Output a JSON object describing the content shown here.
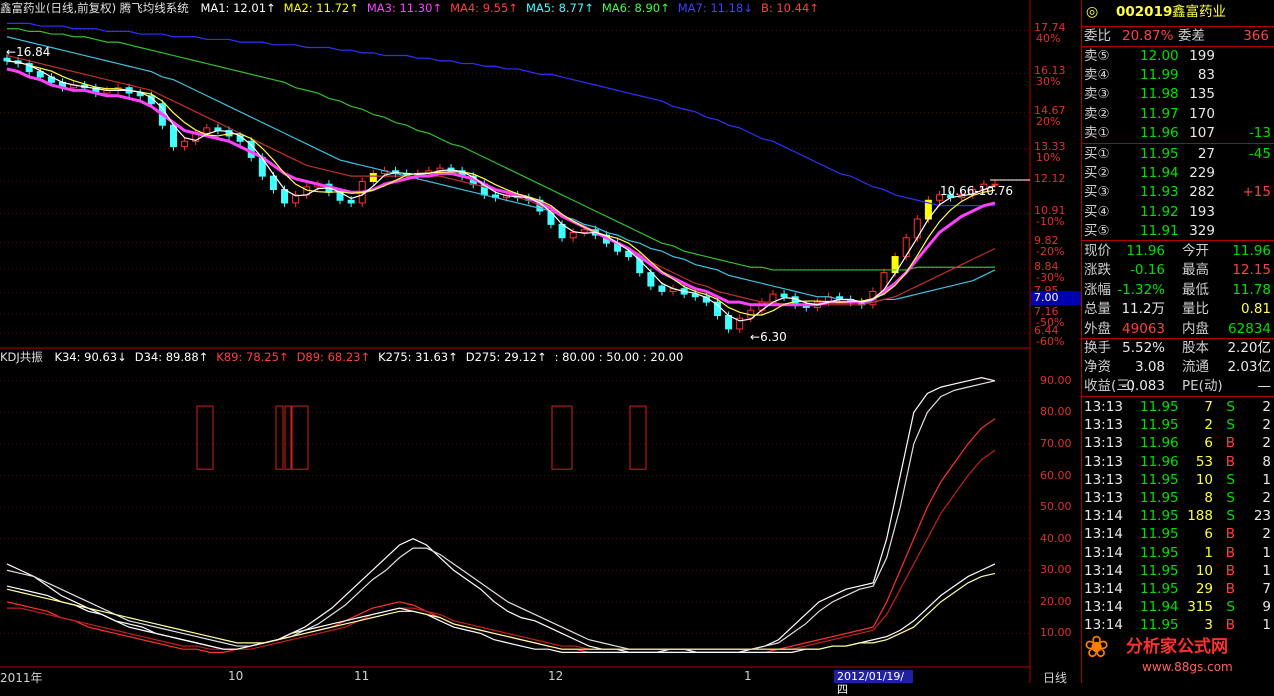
{
  "header": {
    "title": "鑫富药业(日线,前复权) 腾飞均线系统",
    "ma": [
      {
        "label": "MA1: 12.01",
        "arrow": "↑",
        "color": "#ffffff"
      },
      {
        "label": "MA2: 11.72",
        "arrow": "↑",
        "color": "#ffff00"
      },
      {
        "label": "MA3: 11.30",
        "arrow": "↑",
        "color": "#ff40ff"
      },
      {
        "label": "MA4: 9.55",
        "arrow": "↑",
        "color": "#ff4040"
      },
      {
        "label": "MA5: 8.77",
        "arrow": "↑",
        "color": "#40ffff"
      },
      {
        "label": "MA6: 8.90",
        "arrow": "↑",
        "color": "#40ff40"
      },
      {
        "label": "MA7: 11.18",
        "arrow": "↓",
        "color": "#4040ff"
      },
      {
        "label": "B: 10.44",
        "arrow": "↑",
        "color": "#ff4040"
      }
    ]
  },
  "sub_header": {
    "title": "KDJ共振",
    "items": [
      {
        "label": "K34: 90.63",
        "arrow": "↓",
        "color": "#ffffff"
      },
      {
        "label": "D34: 89.88",
        "arrow": "↑",
        "color": "#ffffff"
      },
      {
        "label": "K89: 78.25",
        "arrow": "↑",
        "color": "#ff4040"
      },
      {
        "label": "D89: 68.23",
        "arrow": "↑",
        "color": "#ff4040"
      },
      {
        "label": "K275: 31.63",
        "arrow": "↑",
        "color": "#ffffff"
      },
      {
        "label": "D275: 29.12",
        "arrow": "↑",
        "color": "#ffffff"
      },
      {
        "label": ": 80.00 : 50.00 : 20.00",
        "arrow": "",
        "color": "#ffffff"
      }
    ]
  },
  "price_axis": [
    {
      "price": "17.74",
      "pct": "40%"
    },
    {
      "price": "16.13",
      "pct": "30%"
    },
    {
      "price": "14.67",
      "pct": "20%"
    },
    {
      "price": "13.33",
      "pct": "10%"
    },
    {
      "price": "12.12",
      "pct": ""
    },
    {
      "price": "10.91",
      "pct": "-10%"
    },
    {
      "price": "9.82",
      "pct": "-20%"
    },
    {
      "price": "8.84",
      "pct": "-30%"
    },
    {
      "price": "7.95",
      "pct": "-40%"
    },
    {
      "price": "7.16",
      "pct": "-50%"
    },
    {
      "price": "6.44",
      "pct": "-60%"
    }
  ],
  "kdj_axis": [
    "90.00",
    "80.00",
    "70.00",
    "60.00",
    "50.00",
    "40.00",
    "30.00",
    "20.00",
    "10.00"
  ],
  "annotations": {
    "high": "16.84",
    "low": "6.30",
    "cross": "10.66-10.76",
    "badge": "7.00"
  },
  "x_axis": {
    "labels": [
      "2011年",
      "10",
      "11",
      "12",
      "1",
      "2012/01/19/四"
    ],
    "period": "日线"
  },
  "chart_data": {
    "type": "candlestick",
    "ylim": [
      6.0,
      18.2
    ],
    "kdj_ylim": [
      0,
      95
    ],
    "close": [
      16.6,
      16.5,
      16.2,
      16.0,
      15.8,
      15.6,
      15.7,
      15.6,
      15.4,
      15.5,
      15.6,
      15.4,
      15.3,
      15.0,
      14.2,
      13.4,
      13.6,
      13.9,
      14.1,
      14.0,
      13.8,
      13.6,
      13.0,
      12.3,
      11.8,
      11.3,
      11.6,
      11.9,
      12.0,
      11.7,
      11.4,
      11.3,
      12.1,
      12.4,
      12.5,
      12.4,
      12.3,
      12.4,
      12.5,
      12.6,
      12.5,
      12.3,
      12.0,
      11.6,
      11.5,
      11.6,
      11.5,
      11.4,
      11.0,
      10.5,
      10.0,
      10.2,
      10.3,
      10.1,
      9.8,
      9.5,
      9.3,
      8.7,
      8.2,
      8.0,
      8.1,
      7.9,
      7.8,
      7.6,
      7.1,
      6.6,
      7.0,
      7.3,
      7.6,
      7.9,
      7.8,
      7.5,
      7.4,
      7.6,
      7.8,
      7.7,
      7.6,
      7.5,
      8.0,
      8.7,
      9.3,
      10.0,
      10.7,
      11.4,
      11.6,
      11.5,
      11.6,
      11.8,
      12.0,
      12.0
    ],
    "ma3": [
      16.3,
      16.2,
      16.0,
      15.9,
      15.7,
      15.6,
      15.5,
      15.5,
      15.4,
      15.3,
      15.3,
      15.2,
      15.1,
      14.9,
      14.6,
      14.3,
      14.0,
      13.9,
      13.8,
      13.7,
      13.6,
      13.4,
      13.2,
      13.0,
      12.7,
      12.4,
      12.2,
      12.1,
      12.0,
      11.9,
      11.8,
      11.7,
      11.7,
      11.8,
      12.0,
      12.1,
      12.2,
      12.3,
      12.3,
      12.4,
      12.4,
      12.3,
      12.2,
      12.0,
      11.8,
      11.7,
      11.6,
      11.5,
      11.3,
      11.1,
      10.8,
      10.6,
      10.4,
      10.2,
      10.0,
      9.8,
      9.6,
      9.3,
      9.0,
      8.7,
      8.5,
      8.3,
      8.1,
      8.0,
      7.8,
      7.6,
      7.6,
      7.5,
      7.5,
      7.5,
      7.5,
      7.5,
      7.5,
      7.5,
      7.6,
      7.6,
      7.6,
      7.6,
      7.7,
      8.0,
      8.3,
      8.7,
      9.2,
      9.7,
      10.2,
      10.5,
      10.8,
      11.0,
      11.2,
      11.3
    ],
    "ma4": [
      16.8,
      16.7,
      16.6,
      16.5,
      16.4,
      16.3,
      16.2,
      16.1,
      16.0,
      15.9,
      15.8,
      15.7,
      15.6,
      15.5,
      15.3,
      15.1,
      14.9,
      14.7,
      14.5,
      14.3,
      14.1,
      13.9,
      13.7,
      13.5,
      13.3,
      13.1,
      12.9,
      12.7,
      12.6,
      12.5,
      12.4,
      12.3,
      12.3,
      12.3,
      12.3,
      12.3,
      12.3,
      12.3,
      12.3,
      12.3,
      12.2,
      12.1,
      12.0,
      11.9,
      11.8,
      11.7,
      11.5,
      11.4,
      11.2,
      11.0,
      10.8,
      10.6,
      10.4,
      10.2,
      10.0,
      9.8,
      9.6,
      9.4,
      9.1,
      8.9,
      8.7,
      8.5,
      8.3,
      8.2,
      8.0,
      7.9,
      7.8,
      7.7,
      7.6,
      7.6,
      7.5,
      7.5,
      7.5,
      7.5,
      7.5,
      7.5,
      7.5,
      7.5,
      7.6,
      7.7,
      7.8,
      8.0,
      8.2,
      8.4,
      8.6,
      8.8,
      9.0,
      9.2,
      9.4,
      9.6
    ],
    "ma5": [
      17.5,
      17.4,
      17.3,
      17.2,
      17.1,
      17.0,
      16.9,
      16.8,
      16.7,
      16.6,
      16.5,
      16.4,
      16.3,
      16.2,
      16.0,
      15.9,
      15.7,
      15.5,
      15.3,
      15.1,
      14.9,
      14.7,
      14.5,
      14.3,
      14.1,
      13.9,
      13.7,
      13.5,
      13.3,
      13.1,
      12.9,
      12.8,
      12.7,
      12.6,
      12.5,
      12.4,
      12.3,
      12.2,
      12.1,
      12.0,
      11.9,
      11.8,
      11.7,
      11.6,
      11.5,
      11.4,
      11.3,
      11.2,
      11.1,
      11.0,
      10.8,
      10.7,
      10.5,
      10.4,
      10.2,
      10.1,
      9.9,
      9.8,
      9.6,
      9.5,
      9.3,
      9.2,
      9.0,
      8.9,
      8.8,
      8.6,
      8.5,
      8.4,
      8.3,
      8.2,
      8.1,
      8.0,
      7.9,
      7.8,
      7.8,
      7.7,
      7.7,
      7.6,
      7.6,
      7.7,
      7.7,
      7.8,
      7.9,
      8.0,
      8.1,
      8.2,
      8.3,
      8.4,
      8.6,
      8.8
    ],
    "ma6": [
      17.8,
      17.8,
      17.7,
      17.7,
      17.6,
      17.6,
      17.5,
      17.5,
      17.4,
      17.3,
      17.3,
      17.2,
      17.1,
      17.0,
      16.9,
      16.8,
      16.7,
      16.6,
      16.5,
      16.4,
      16.3,
      16.2,
      16.1,
      16.0,
      15.9,
      15.8,
      15.6,
      15.5,
      15.4,
      15.2,
      15.1,
      14.9,
      14.8,
      14.6,
      14.5,
      14.3,
      14.2,
      14.0,
      13.9,
      13.7,
      13.5,
      13.4,
      13.2,
      13.0,
      12.8,
      12.6,
      12.4,
      12.2,
      12.0,
      11.8,
      11.6,
      11.4,
      11.2,
      11.0,
      10.8,
      10.6,
      10.4,
      10.2,
      10.0,
      9.8,
      9.7,
      9.5,
      9.4,
      9.3,
      9.2,
      9.1,
      9.0,
      8.9,
      8.9,
      8.8,
      8.8,
      8.8,
      8.8,
      8.8,
      8.8,
      8.8,
      8.8,
      8.8,
      8.8,
      8.8,
      8.8,
      8.8,
      8.9,
      8.9,
      8.9,
      8.9,
      8.9,
      8.9,
      8.9,
      8.9
    ],
    "ma7": [
      18.0,
      18.0,
      18.0,
      17.9,
      17.9,
      17.9,
      17.8,
      17.8,
      17.8,
      17.7,
      17.7,
      17.7,
      17.6,
      17.6,
      17.6,
      17.5,
      17.5,
      17.5,
      17.4,
      17.4,
      17.4,
      17.3,
      17.3,
      17.3,
      17.2,
      17.2,
      17.2,
      17.1,
      17.1,
      17.1,
      17.0,
      17.0,
      16.9,
      16.9,
      16.8,
      16.8,
      16.8,
      16.7,
      16.7,
      16.6,
      16.6,
      16.5,
      16.5,
      16.4,
      16.4,
      16.3,
      16.3,
      16.2,
      16.1,
      16.1,
      16.0,
      15.9,
      15.8,
      15.7,
      15.6,
      15.5,
      15.4,
      15.3,
      15.2,
      15.1,
      14.9,
      14.8,
      14.7,
      14.5,
      14.4,
      14.2,
      14.1,
      13.9,
      13.7,
      13.6,
      13.4,
      13.2,
      13.0,
      12.8,
      12.6,
      12.4,
      12.3,
      12.1,
      11.9,
      11.8,
      11.6,
      11.5,
      11.4,
      11.3,
      11.2,
      11.2,
      11.2,
      11.2,
      11.2,
      11.2
    ],
    "k34": [
      32,
      30,
      28,
      25,
      22,
      20,
      18,
      16,
      14,
      12,
      11,
      10,
      9,
      8,
      7,
      6,
      5,
      5,
      6,
      7,
      8,
      10,
      12,
      15,
      18,
      22,
      26,
      30,
      34,
      38,
      40,
      38,
      34,
      30,
      27,
      24,
      20,
      17,
      15,
      14,
      12,
      10,
      8,
      6,
      5,
      5,
      4,
      4,
      4,
      5,
      5,
      4,
      4,
      4,
      4,
      5,
      6,
      8,
      12,
      16,
      20,
      22,
      24,
      25,
      26,
      40,
      60,
      80,
      86,
      88,
      89,
      90,
      91,
      90
    ],
    "d34": [
      30,
      29,
      28,
      26,
      24,
      22,
      20,
      18,
      16,
      14,
      13,
      12,
      11,
      10,
      9,
      8,
      7,
      6,
      6,
      7,
      8,
      9,
      11,
      13,
      16,
      19,
      23,
      27,
      30,
      34,
      37,
      37,
      35,
      32,
      29,
      26,
      23,
      20,
      18,
      16,
      14,
      12,
      10,
      8,
      7,
      6,
      5,
      5,
      5,
      5,
      5,
      5,
      5,
      5,
      5,
      5,
      6,
      7,
      10,
      13,
      17,
      20,
      22,
      24,
      25,
      34,
      50,
      70,
      80,
      85,
      87,
      88,
      89,
      90
    ],
    "k89": [
      20,
      19,
      18,
      17,
      15,
      14,
      12,
      11,
      10,
      9,
      8,
      7,
      6,
      5,
      5,
      4,
      4,
      5,
      6,
      7,
      8,
      9,
      10,
      11,
      12,
      14,
      16,
      18,
      19,
      20,
      19,
      17,
      15,
      13,
      12,
      11,
      10,
      9,
      8,
      7,
      6,
      5,
      5,
      4,
      4,
      4,
      4,
      4,
      4,
      4,
      4,
      4,
      4,
      4,
      4,
      4,
      4,
      5,
      6,
      7,
      8,
      9,
      10,
      11,
      12,
      20,
      30,
      40,
      50,
      58,
      64,
      70,
      75,
      78
    ],
    "d89": [
      18,
      18,
      17,
      16,
      15,
      14,
      13,
      12,
      11,
      10,
      9,
      8,
      7,
      6,
      6,
      5,
      5,
      5,
      5,
      6,
      7,
      8,
      9,
      10,
      11,
      12,
      14,
      16,
      17,
      18,
      18,
      17,
      16,
      14,
      13,
      12,
      11,
      10,
      9,
      8,
      7,
      6,
      6,
      5,
      5,
      5,
      5,
      5,
      5,
      5,
      5,
      5,
      5,
      5,
      5,
      5,
      5,
      5,
      5,
      6,
      7,
      8,
      9,
      10,
      11,
      16,
      24,
      32,
      40,
      48,
      54,
      60,
      65,
      68
    ],
    "k275": [
      25,
      24,
      23,
      22,
      20,
      19,
      17,
      16,
      14,
      13,
      12,
      10,
      9,
      8,
      7,
      6,
      5,
      5,
      6,
      7,
      8,
      10,
      11,
      12,
      13,
      14,
      15,
      16,
      17,
      18,
      17,
      16,
      14,
      12,
      11,
      10,
      8,
      7,
      6,
      5,
      5,
      4,
      4,
      4,
      4,
      4,
      4,
      4,
      4,
      4,
      4,
      4,
      4,
      4,
      4,
      4,
      4,
      4,
      4,
      5,
      5,
      6,
      6,
      7,
      8,
      9,
      11,
      14,
      18,
      22,
      25,
      28,
      30,
      32
    ],
    "d275": [
      24,
      23,
      22,
      21,
      20,
      19,
      18,
      17,
      16,
      15,
      14,
      13,
      12,
      11,
      10,
      9,
      8,
      7,
      7,
      7,
      8,
      9,
      10,
      11,
      12,
      13,
      14,
      15,
      16,
      17,
      17,
      16,
      15,
      13,
      12,
      11,
      10,
      9,
      8,
      7,
      6,
      5,
      5,
      5,
      5,
      5,
      5,
      5,
      5,
      5,
      5,
      5,
      5,
      5,
      5,
      5,
      5,
      5,
      5,
      5,
      5,
      6,
      6,
      7,
      7,
      8,
      10,
      12,
      16,
      20,
      23,
      26,
      28,
      29
    ],
    "signal_boxes": [
      [
        197,
        213
      ],
      [
        276,
        283
      ],
      [
        285,
        291
      ],
      [
        292,
        308
      ],
      [
        552,
        572
      ],
      [
        630,
        646
      ]
    ]
  },
  "panel": {
    "code": "002019",
    "name": "鑫富药业",
    "weibi_label": "委比",
    "weibi": "20.87%",
    "weicha_label": "委差",
    "weicha": "366",
    "asks": [
      {
        "label": "卖⑤",
        "price": "12.00",
        "vol": "199",
        "chg": ""
      },
      {
        "label": "卖④",
        "price": "11.99",
        "vol": "83",
        "chg": ""
      },
      {
        "label": "卖③",
        "price": "11.98",
        "vol": "135",
        "chg": ""
      },
      {
        "label": "卖②",
        "price": "11.97",
        "vol": "170",
        "chg": ""
      },
      {
        "label": "卖①",
        "price": "11.96",
        "vol": "107",
        "chg": "-13"
      }
    ],
    "bids": [
      {
        "label": "买①",
        "price": "11.95",
        "vol": "27",
        "chg": "-45"
      },
      {
        "label": "买②",
        "price": "11.94",
        "vol": "229",
        "chg": ""
      },
      {
        "label": "买③",
        "price": "11.93",
        "vol": "282",
        "chg": "+15"
      },
      {
        "label": "买④",
        "price": "11.92",
        "vol": "193",
        "chg": ""
      },
      {
        "label": "买⑤",
        "price": "11.91",
        "vol": "329",
        "chg": ""
      }
    ],
    "quote": [
      {
        "l1": "现价",
        "v1": "11.96",
        "c1": "g",
        "l2": "今开",
        "v2": "11.96",
        "c2": "g"
      },
      {
        "l1": "涨跌",
        "v1": "-0.16",
        "c1": "g",
        "l2": "最高",
        "v2": "12.15",
        "c2": "r"
      },
      {
        "l1": "涨幅",
        "v1": "-1.32%",
        "c1": "g",
        "l2": "最低",
        "v2": "11.78",
        "c2": "g"
      },
      {
        "l1": "总量",
        "v1": "11.2万",
        "c1": "w",
        "l2": "量比",
        "v2": "0.81",
        "c2": "y"
      },
      {
        "l1": "外盘",
        "v1": "49063",
        "c1": "r",
        "l2": "内盘",
        "v2": "62834",
        "c2": "g"
      }
    ],
    "fund": [
      {
        "l1": "换手",
        "v1": "5.52%",
        "l2": "股本",
        "v2": "2.20亿"
      },
      {
        "l1": "净资",
        "v1": "3.08",
        "l2": "流通",
        "v2": "2.03亿"
      },
      {
        "l1": "收益(三)",
        "v1": "-0.083",
        "l2": "PE(动)",
        "v2": "—"
      }
    ],
    "ticks": [
      {
        "time": "13:13",
        "price": "11.95",
        "vol": "7",
        "side": "S",
        "n": "2"
      },
      {
        "time": "13:13",
        "price": "11.95",
        "vol": "2",
        "side": "S",
        "n": "2"
      },
      {
        "time": "13:13",
        "price": "11.96",
        "vol": "6",
        "side": "B",
        "n": "2"
      },
      {
        "time": "13:13",
        "price": "11.96",
        "vol": "53",
        "side": "B",
        "n": "8"
      },
      {
        "time": "13:13",
        "price": "11.95",
        "vol": "10",
        "side": "S",
        "n": "1"
      },
      {
        "time": "13:13",
        "price": "11.95",
        "vol": "8",
        "side": "S",
        "n": "2"
      },
      {
        "time": "13:14",
        "price": "11.95",
        "vol": "188",
        "side": "S",
        "n": "23"
      },
      {
        "time": "13:14",
        "price": "11.95",
        "vol": "6",
        "side": "B",
        "n": "2"
      },
      {
        "time": "13:14",
        "price": "11.95",
        "vol": "1",
        "side": "B",
        "n": "1"
      },
      {
        "time": "13:14",
        "price": "11.95",
        "vol": "10",
        "side": "B",
        "n": "1"
      },
      {
        "time": "13:14",
        "price": "11.95",
        "vol": "29",
        "side": "B",
        "n": "7"
      },
      {
        "time": "13:14",
        "price": "11.94",
        "vol": "315",
        "side": "S",
        "n": "9"
      },
      {
        "time": "13:14",
        "price": "11.95",
        "vol": "3",
        "side": "B",
        "n": "1"
      }
    ],
    "logo": "分析家公式网",
    "logo_url": "www.88gs.com"
  },
  "colors": {
    "up": "#ff3030",
    "down": "#40ffff",
    "grid": "#b00000",
    "ma3": "#ff40ff"
  }
}
